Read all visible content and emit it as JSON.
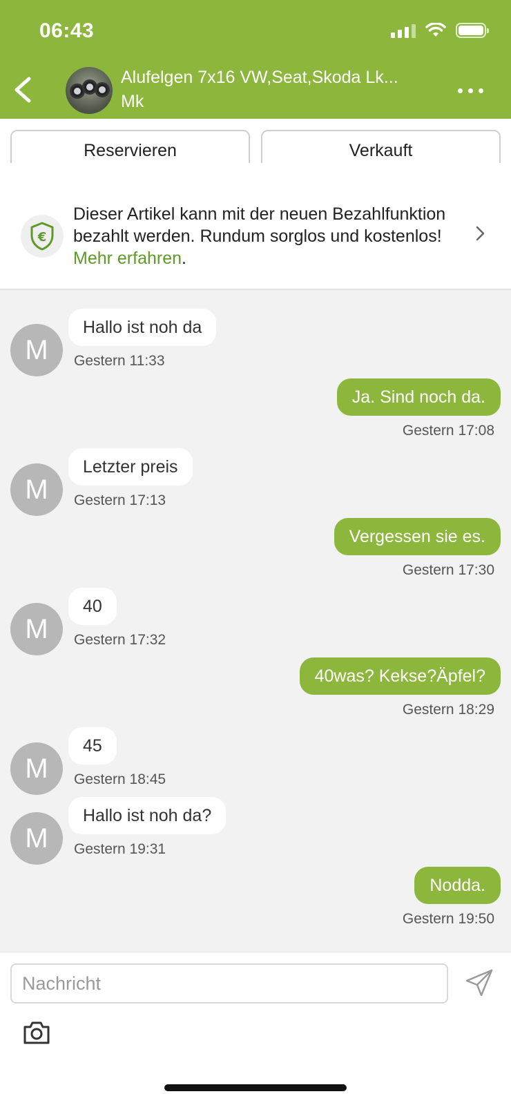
{
  "status_bar": {
    "time": "06:43"
  },
  "header": {
    "title": "Alufelgen 7x16 VW,Seat,Skoda Lk...",
    "subtitle": "Mk"
  },
  "actions": {
    "reserve_label": "Reservieren",
    "sold_label": "Verkauft"
  },
  "banner": {
    "text": "Dieser Artikel kann mit der neuen Bezahlfunktion bezahlt werden. Rundum sorglos und kostenlos! ",
    "link": "Mehr erfahren",
    "suffix": "."
  },
  "messages": [
    {
      "dir": "in",
      "avatar": "M",
      "text": "Hallo ist noh da",
      "time": "Gestern 11:33"
    },
    {
      "dir": "out",
      "text": "Ja. Sind noch da.",
      "time": "Gestern 17:08"
    },
    {
      "dir": "in",
      "avatar": "M",
      "text": "Letzter preis",
      "time": "Gestern 17:13"
    },
    {
      "dir": "out",
      "text": "Vergessen sie es.",
      "time": "Gestern 17:30"
    },
    {
      "dir": "in",
      "avatar": "M",
      "text": "40",
      "time": "Gestern 17:32"
    },
    {
      "dir": "out",
      "text": "40was? Kekse?Äpfel?",
      "time": "Gestern 18:29"
    },
    {
      "dir": "in",
      "avatar": "M",
      "text": "45",
      "time": "Gestern 18:45"
    },
    {
      "dir": "in",
      "avatar": "M",
      "text": "Hallo ist noh da?",
      "time": "Gestern 19:31"
    },
    {
      "dir": "out",
      "text": "Nodda.",
      "time": "Gestern 19:50"
    }
  ],
  "composer": {
    "placeholder": "Nachricht"
  },
  "colors": {
    "brand": "#8cb63c",
    "link": "#5f9a28",
    "avatar": "#b7b7b7"
  }
}
